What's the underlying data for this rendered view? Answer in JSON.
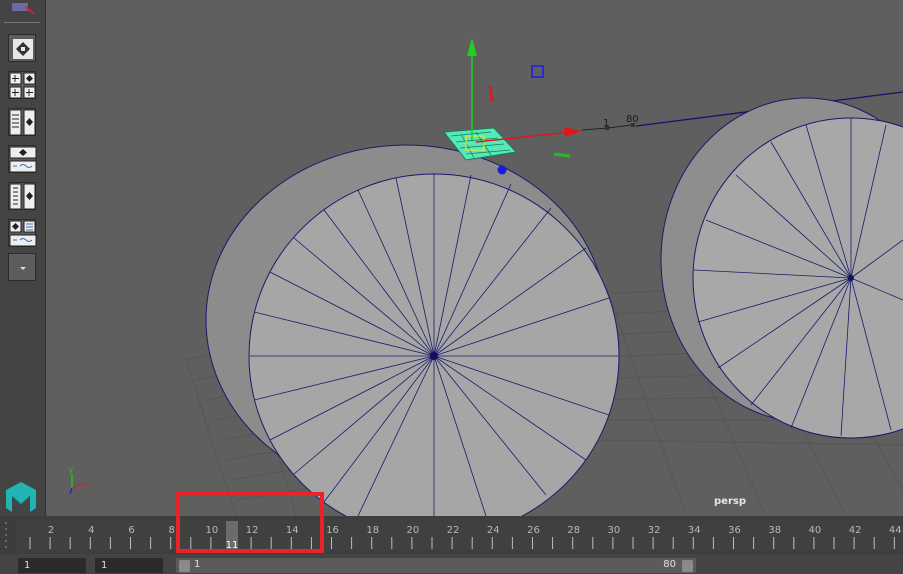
{
  "viewport": {
    "camera_label": "persp",
    "manipulator_labels": [
      "1",
      "80"
    ]
  },
  "toolbox": {
    "icons": [
      "layout-quad-icon",
      "layout-grid-icon",
      "layout-columns-icon",
      "outliner-icon",
      "graph-editor-icon",
      "layout-stack-icon",
      "render-view-icon",
      "channel-box-icon",
      "expand-more-icon"
    ]
  },
  "timeline": {
    "tick_labels": [
      "2",
      "4",
      "6",
      "8",
      "10",
      "12",
      "14",
      "16",
      "18",
      "20",
      "22",
      "24",
      "26",
      "28",
      "30",
      "32",
      "34",
      "36",
      "38",
      "40",
      "42",
      "44"
    ],
    "current_frame": "11"
  },
  "range": {
    "start_field": "1",
    "start_anim_field": "1",
    "slider_start": "1",
    "slider_end": "80"
  },
  "colors": {
    "highlight": "#e8242b",
    "x_axis": "#e01818",
    "y_axis": "#1ed21e",
    "z_axis": "#1a1ae0",
    "selection": "#40f0b0"
  }
}
